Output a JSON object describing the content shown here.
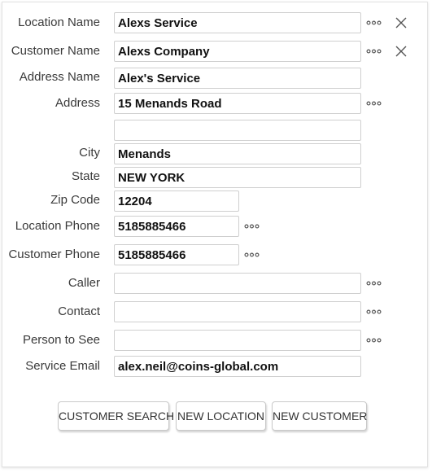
{
  "form": {
    "location_name": {
      "label": "Location Name",
      "value": "Alexs Service"
    },
    "customer_name": {
      "label": "Customer Name",
      "value": "Alexs Company"
    },
    "address_name": {
      "label": "Address Name",
      "value": "Alex's Service"
    },
    "address": {
      "label": "Address",
      "value": "15 Menands Road"
    },
    "address_line2": {
      "value": ""
    },
    "city": {
      "label": "City",
      "value": "Menands"
    },
    "state": {
      "label": "State",
      "value": "NEW YORK"
    },
    "zip": {
      "label": "Zip Code",
      "value": "12204"
    },
    "location_phone": {
      "label": "Location Phone",
      "value": "5185885466"
    },
    "customer_phone": {
      "label": "Customer Phone",
      "value": "5185885466"
    },
    "caller": {
      "label": "Caller",
      "value": ""
    },
    "contact": {
      "label": "Contact",
      "value": ""
    },
    "person_to_see": {
      "label": "Person to See",
      "value": ""
    },
    "service_email": {
      "label": "Service Email",
      "value": "alex.neil@coins-global.com"
    }
  },
  "buttons": {
    "customer_search": "CUSTOMER SEARCH",
    "new_location": "NEW LOCATION",
    "new_customer": "NEW CUSTOMER"
  },
  "icons": {
    "more": "more-options-icon",
    "clear": "close-icon"
  },
  "colors": {
    "label_text": "#3a3a3a",
    "field_border": "#cfcfcf",
    "value_text": "#111111",
    "icon": "#555555"
  }
}
